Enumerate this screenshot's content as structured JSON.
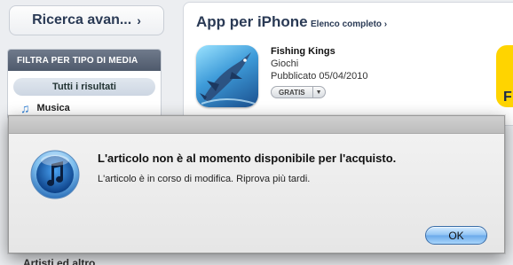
{
  "sidebar": {
    "advanced_search_label": "Ricerca avan...",
    "filter_header": "FILTRA PER TIPO DI MEDIA",
    "all_results_label": "Tutti i risultati",
    "music_label": "Musica",
    "artists_label": "Artisti ed altro"
  },
  "iphone_apps": {
    "title": "App per iPhone",
    "see_all_label": "Elenco completo",
    "app": {
      "name": "Fishing Kings",
      "category": "Giochi",
      "published": "Pubblicato 05/04/2010",
      "price_label": "GRATIS",
      "icon": "marlin-fish-icon"
    },
    "next_app_icon_letter": "F"
  },
  "dialog": {
    "title": "L'articolo non è al momento disponibile per l'acquisto.",
    "message": "L'articolo è in corso di modifica. Riprova più tardi.",
    "ok_label": "OK",
    "icon": "itunes-icon"
  },
  "colors": {
    "accent_blue": "#2d7fd6",
    "header_gray": "#5a6577",
    "ok_button": "#8ec3f4"
  }
}
